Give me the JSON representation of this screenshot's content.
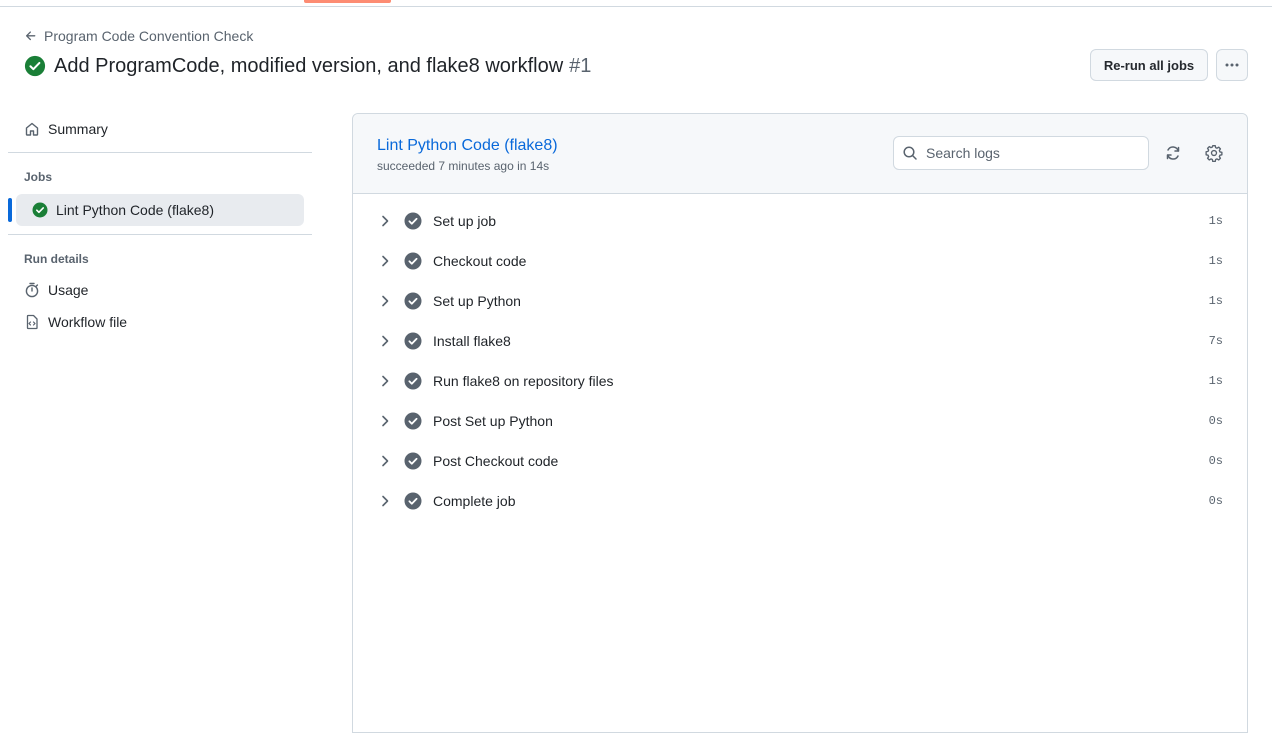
{
  "header": {
    "back_label": "Program Code Convention Check",
    "title": "Add ProgramCode, modified version, and flake8 workflow",
    "run_number": "#1",
    "rerun_label": "Re-run all jobs",
    "more_icon": "kebab-horizontal-icon",
    "status_icon": "check-circle-fill-icon"
  },
  "colors": {
    "success": "#1a7f37",
    "link": "#0969da",
    "accent_underline": "#fd8c73",
    "selected_marker": "#0969da"
  },
  "sidebar": {
    "summary_label": "Summary",
    "jobs_heading": "Jobs",
    "job_label": "Lint Python Code (flake8)",
    "run_details_heading": "Run details",
    "usage_label": "Usage",
    "workflow_file_label": "Workflow file"
  },
  "job": {
    "title": "Lint Python Code (flake8)",
    "subtitle": "succeeded 7 minutes ago in 14s",
    "search_placeholder": "Search logs"
  },
  "steps": [
    {
      "name": "Set up job",
      "duration": "1s"
    },
    {
      "name": "Checkout code",
      "duration": "1s"
    },
    {
      "name": "Set up Python",
      "duration": "1s"
    },
    {
      "name": "Install flake8",
      "duration": "7s"
    },
    {
      "name": "Run flake8 on repository files",
      "duration": "1s"
    },
    {
      "name": "Post Set up Python",
      "duration": "0s"
    },
    {
      "name": "Post Checkout code",
      "duration": "0s"
    },
    {
      "name": "Complete job",
      "duration": "0s"
    }
  ]
}
